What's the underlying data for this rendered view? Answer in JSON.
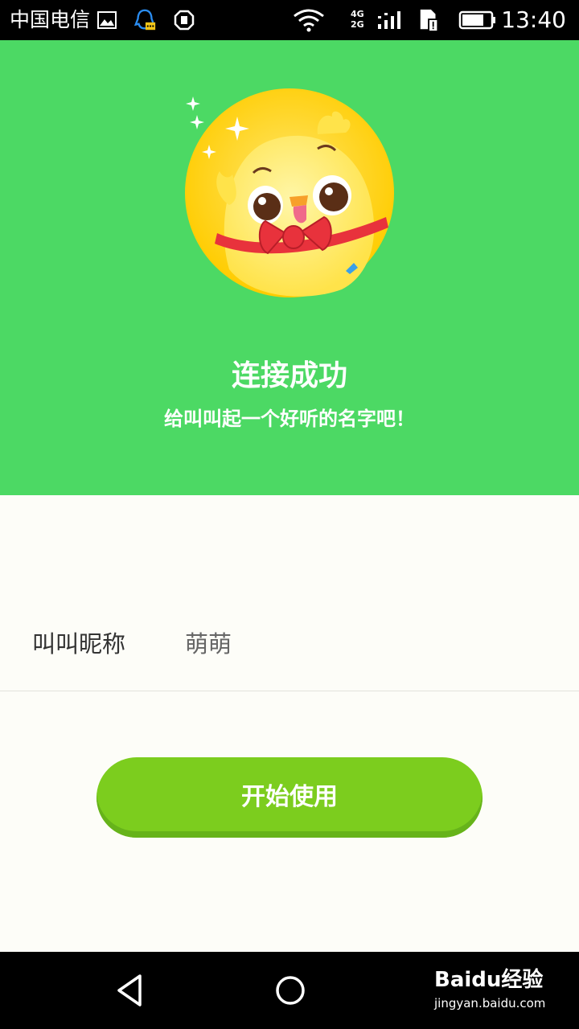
{
  "status_bar": {
    "carrier": "中国电信",
    "network_top": "4G",
    "network_bottom": "2G",
    "time": "13:40"
  },
  "header": {
    "title": "连接成功",
    "subtitle": "给叫叫起一个好听的名字吧！",
    "avatar_icon": "chick-mascot-icon"
  },
  "form": {
    "nickname_label": "叫叫昵称",
    "nickname_value": "萌萌"
  },
  "actions": {
    "start_label": "开始使用"
  },
  "watermark": {
    "logo": "Baidu经验",
    "url": "jingyan.baidu.com"
  },
  "colors": {
    "header_bg": "#4cd964",
    "button_bg": "#7ccd1e",
    "content_bg": "#fdfdf8"
  }
}
